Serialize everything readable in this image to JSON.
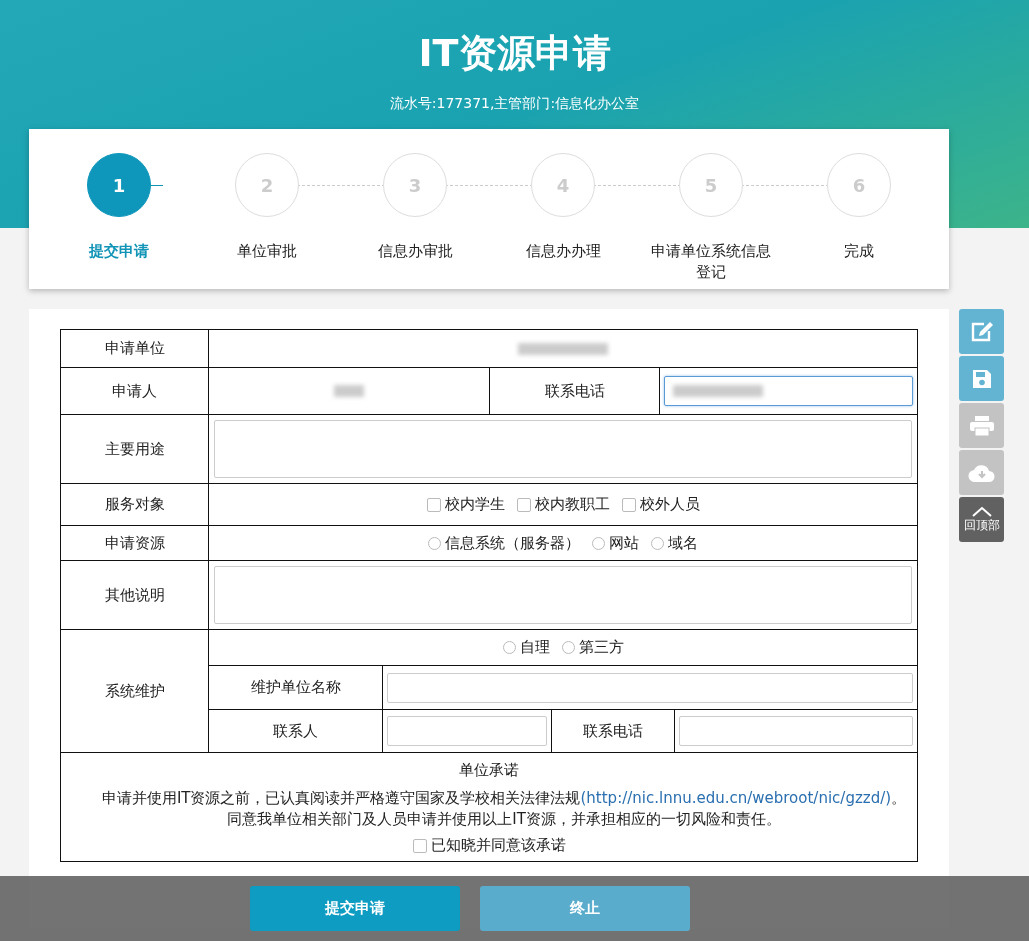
{
  "header": {
    "title": "IT资源申请",
    "subtitle": "流水号:177371,主管部门:信息化办公室"
  },
  "steps": [
    {
      "number": "1",
      "label": "提交申请",
      "selected": true
    },
    {
      "number": "2",
      "label": "单位审批",
      "selected": false
    },
    {
      "number": "3",
      "label": "信息办审批",
      "selected": false
    },
    {
      "number": "4",
      "label": "信息办办理",
      "selected": false
    },
    {
      "number": "5",
      "label": "申请单位系统信息登记",
      "selected": false
    },
    {
      "number": "6",
      "label": "完成",
      "selected": false
    }
  ],
  "form": {
    "rows": [
      {
        "kind": "value",
        "label": "申请单位",
        "redacted": true
      },
      {
        "kind": "person",
        "label": "申请人",
        "redacted": true,
        "phone_label": "联系电话",
        "phone_redacted": true,
        "phone_focused": true
      },
      {
        "kind": "textarea",
        "label": "主要用途"
      },
      {
        "kind": "checkboxes",
        "label": "服务对象",
        "options": [
          {
            "label": "校内学生",
            "checked": false
          },
          {
            "label": "校内教职工",
            "checked": false
          },
          {
            "label": "校外人员",
            "checked": false
          }
        ]
      },
      {
        "kind": "radios",
        "label": "申请资源",
        "options": [
          {
            "label": "信息系统（服务器）",
            "selected": false
          },
          {
            "label": "网站",
            "selected": false
          },
          {
            "label": "域名",
            "selected": false
          }
        ]
      },
      {
        "kind": "textarea",
        "label": "其他说明"
      },
      {
        "kind": "maintenance",
        "label": "系统维护",
        "options": [
          {
            "label": "自理",
            "selected": false
          },
          {
            "label": "第三方",
            "selected": false
          }
        ],
        "unit_label": "维护单位名称",
        "contact_label": "联系人",
        "phone_label": "联系电话"
      }
    ],
    "pledge": {
      "title": "单位承诺",
      "paragraphs": [
        {
          "text": "申请并使用IT资源之前，已认真阅读并严格遵守国家及学校相关法律法规",
          "link": "(http://nic.lnnu.edu.cn/webroot/nic/gzzd/)",
          "tail": "。"
        },
        {
          "text": "同意我单位相关部门及人员申请并使用以上IT资源，并承担相应的一切风险和责任。"
        }
      ],
      "agree": {
        "label": "已知晓并同意该承诺",
        "checked": false
      }
    }
  },
  "toolbar": [
    {
      "kind": "edit",
      "disabled": false
    },
    {
      "kind": "save",
      "disabled": false
    },
    {
      "kind": "print",
      "disabled": true
    },
    {
      "kind": "download",
      "disabled": true
    },
    {
      "kind": "top",
      "label": "回顶部",
      "disabled": false
    }
  ],
  "actions": [
    {
      "kind": "primary",
      "label": "提交申请"
    },
    {
      "kind": "secondary",
      "label": "终止"
    }
  ]
}
